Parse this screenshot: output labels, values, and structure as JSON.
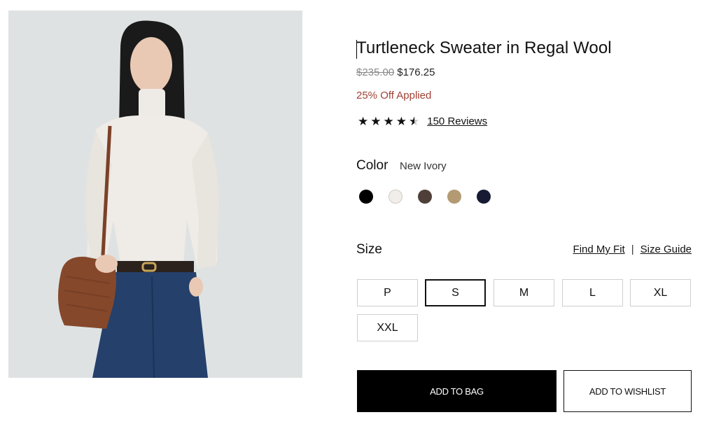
{
  "product": {
    "title": "Turtleneck Sweater in Regal Wool",
    "price_original": "$235.00",
    "price_sale": "$176.25",
    "discount_text": "25% Off Applied",
    "rating": {
      "stars": 4.5,
      "reviews_label": "150 Reviews"
    }
  },
  "color": {
    "label": "Color",
    "selected": "New Ivory",
    "swatches": [
      {
        "name": "black",
        "hex": "#000000"
      },
      {
        "name": "new-ivory",
        "hex": "#f1eeea",
        "selected": true
      },
      {
        "name": "brown",
        "hex": "#4e3f38"
      },
      {
        "name": "camel",
        "hex": "#b39a72"
      },
      {
        "name": "navy",
        "hex": "#171a33"
      }
    ]
  },
  "size": {
    "label": "Size",
    "find_fit": "Find My Fit",
    "separator": "|",
    "size_guide": "Size Guide",
    "options": [
      "P",
      "S",
      "M",
      "L",
      "XL",
      "XXL"
    ],
    "selected": "S"
  },
  "actions": {
    "add_to_bag": "ADD TO BAG",
    "add_to_wishlist": "ADD TO WISHLIST"
  },
  "colors": {
    "discount": "#a04134",
    "primary_button": "#000000",
    "image_background": "#dfe2e3"
  }
}
